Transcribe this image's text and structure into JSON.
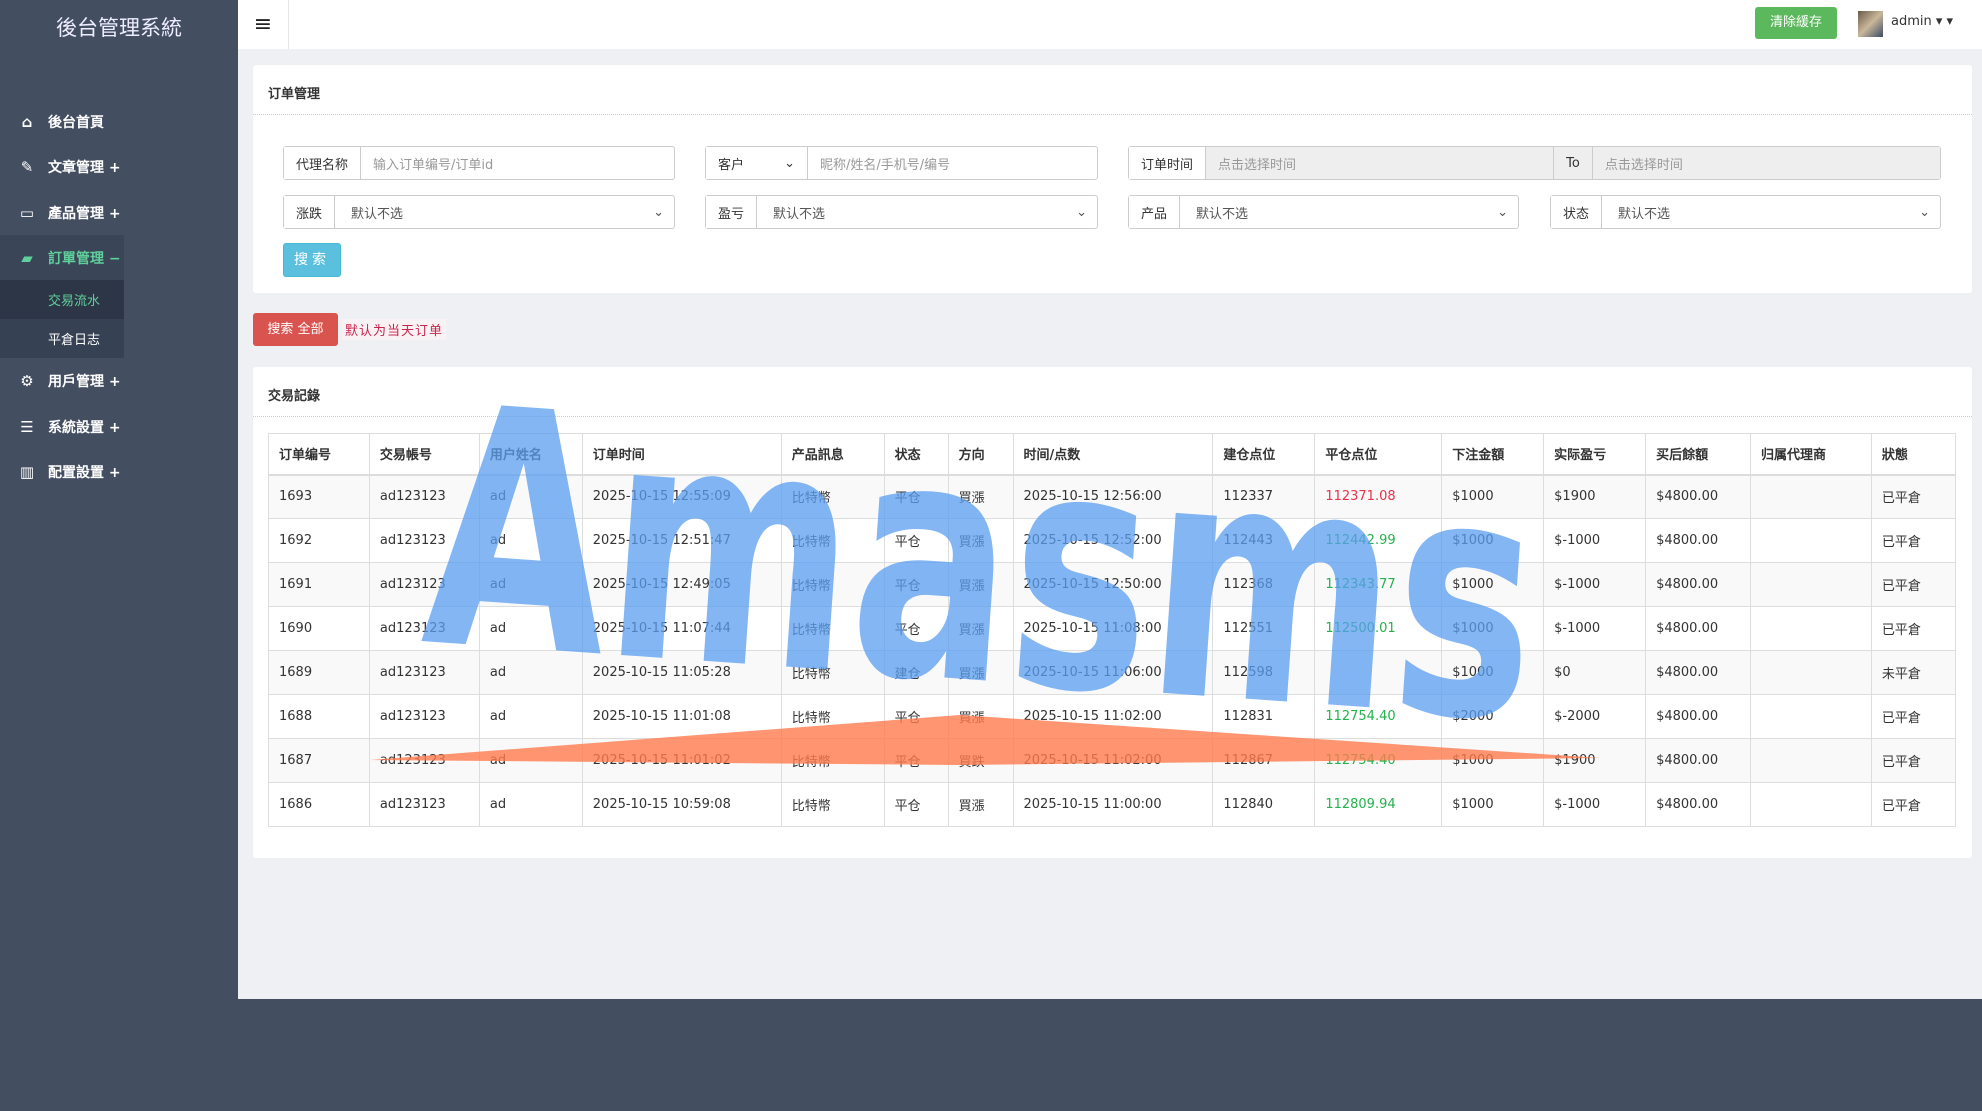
{
  "app_title": "後台管理系統",
  "sidebar": {
    "items": [
      {
        "label": "後台首頁",
        "icon": "home-icon"
      },
      {
        "label": "文章管理 +",
        "icon": "pencil-icon"
      },
      {
        "label": "產品管理 +",
        "icon": "laptop-icon"
      },
      {
        "label": "訂單管理 −",
        "icon": "book-icon"
      },
      {
        "label": "用戶管理 +",
        "icon": "gears-icon"
      },
      {
        "label": "系統設置 +",
        "icon": "server-icon"
      },
      {
        "label": "配置設置 +",
        "icon": "bar-chart-icon"
      }
    ],
    "subitems": [
      {
        "label": "交易流水"
      },
      {
        "label": "平倉日志"
      }
    ]
  },
  "topbar": {
    "clear_cache": "清除緩存",
    "user": "admin ▾ ▾"
  },
  "filter": {
    "title": "订单管理",
    "agent_label": "代理名称",
    "agent_placeholder": "输入订单编号/订单id",
    "customer_select": "客户",
    "customer_placeholder": "昵称/姓名/手机号/编号",
    "time_label": "订单时间",
    "time_from_placeholder": "点击选择时间",
    "to_label": "To",
    "time_to_placeholder": "点击选择时间",
    "rise_label": "涨跌",
    "rise_value": "默认不选",
    "pnl_label": "盈亏",
    "pnl_value": "默认不选",
    "product_label": "产品",
    "product_value": "默认不选",
    "status_label": "状态",
    "status_value": "默认不选",
    "search": "搜索"
  },
  "search_all": "搜索 全部",
  "search_note": "默认为当天订单",
  "records": {
    "title": "交易記錄",
    "headers": [
      "订单编号",
      "交易帳号",
      "用户姓名",
      "订单时间",
      "产品訊息",
      "状态",
      "方向",
      "时间/点数",
      "建仓点位",
      "平仓点位",
      "下注金額",
      "实际盈亏",
      "买后餘額",
      "归属代理商",
      "狀態"
    ],
    "rows": [
      [
        "1693",
        "ad123123",
        "ad",
        "2025-10-15 12:55:09",
        "比特幣",
        "平仓",
        "買漲",
        "2025-10-15 12:56:00",
        "112337",
        "112371.08",
        "$1000",
        "$1900",
        "$4800.00",
        "",
        "已平倉"
      ],
      [
        "1692",
        "ad123123",
        "ad",
        "2025-10-15 12:51:47",
        "比特幣",
        "平仓",
        "買漲",
        "2025-10-15 12:52:00",
        "112443",
        "112442.99",
        "$1000",
        "$-1000",
        "$4800.00",
        "",
        "已平倉"
      ],
      [
        "1691",
        "ad123123",
        "ad",
        "2025-10-15 12:49:05",
        "比特幣",
        "平仓",
        "買漲",
        "2025-10-15 12:50:00",
        "112368",
        "112343.77",
        "$1000",
        "$-1000",
        "$4800.00",
        "",
        "已平倉"
      ],
      [
        "1690",
        "ad123123",
        "ad",
        "2025-10-15 11:07:44",
        "比特幣",
        "平仓",
        "買漲",
        "2025-10-15 11:08:00",
        "112551",
        "112500.01",
        "$1000",
        "$-1000",
        "$4800.00",
        "",
        "已平倉"
      ],
      [
        "1689",
        "ad123123",
        "ad",
        "2025-10-15 11:05:28",
        "比特幣",
        "建仓",
        "買漲",
        "2025-10-15 11:06:00",
        "112598",
        "",
        "$1000",
        "$0",
        "$4800.00",
        "",
        "未平倉"
      ],
      [
        "1688",
        "ad123123",
        "ad",
        "2025-10-15 11:01:08",
        "比特幣",
        "平仓",
        "買漲",
        "2025-10-15 11:02:00",
        "112831",
        "112754.40",
        "$2000",
        "$-2000",
        "$4800.00",
        "",
        "已平倉"
      ],
      [
        "1687",
        "ad123123",
        "ad",
        "2025-10-15 11:01:02",
        "比特幣",
        "平仓",
        "買跌",
        "2025-10-15 11:02:00",
        "112867",
        "112754.40",
        "$1000",
        "$1900",
        "$4800.00",
        "",
        "已平倉"
      ],
      [
        "1686",
        "ad123123",
        "ad",
        "2025-10-15 10:59:08",
        "比特幣",
        "平仓",
        "買漲",
        "2025-10-15 11:00:00",
        "112840",
        "112809.94",
        "$1000",
        "$-1000",
        "$4800.00",
        "",
        "已平倉"
      ]
    ],
    "close_colors": [
      "up",
      "down",
      "down",
      "down",
      "",
      "down",
      "down",
      "down"
    ]
  },
  "colors": {
    "sidebar": "#434e61",
    "accent_green": "#5fcf9b",
    "up": "#e8334a",
    "down": "#24b14d",
    "info": "#5bc0de",
    "danger": "#d9534f",
    "success": "#5cb85c"
  },
  "watermark": "Amasms"
}
